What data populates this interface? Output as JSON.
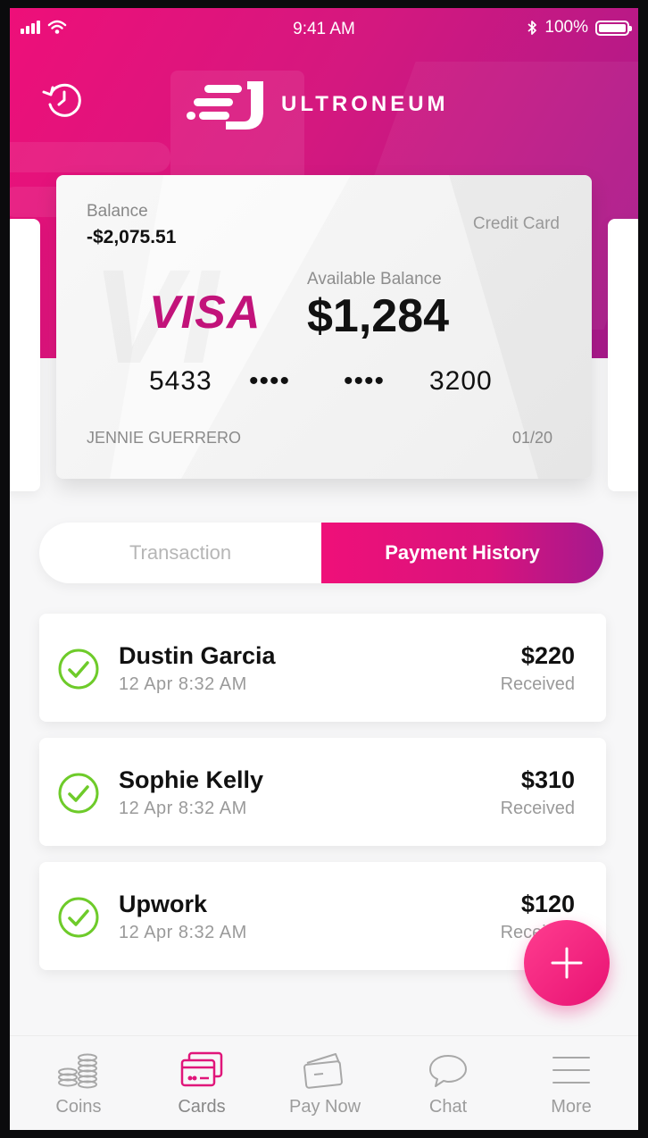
{
  "status_bar": {
    "time": "9:41 AM",
    "battery": "100%"
  },
  "brand": {
    "name": "ULTRONEUM"
  },
  "card": {
    "balance_label": "Balance",
    "balance_value": "-$2,075.51",
    "card_type": "Credit Card",
    "network": "VISA",
    "available_label": "Available Balance",
    "available_value": "$1,284",
    "number_groups": [
      "5433",
      "••••",
      "••••",
      "3200"
    ],
    "holder": "JENNIE GUERRERO",
    "expiry": "01/20"
  },
  "tabs": [
    {
      "label": "Transaction",
      "active": false
    },
    {
      "label": "Payment History",
      "active": true
    }
  ],
  "transactions": [
    {
      "name": "Dustin Garcia",
      "date": "12 Apr 8:32 AM",
      "amount": "$220",
      "status": "Received"
    },
    {
      "name": "Sophie Kelly",
      "date": "12 Apr 8:32 AM",
      "amount": "$310",
      "status": "Received"
    },
    {
      "name": "Upwork",
      "date": "12 Apr 8:32 AM",
      "amount": "$120",
      "status": "Received"
    }
  ],
  "nav": [
    {
      "label": "Coins",
      "icon": "coins-icon"
    },
    {
      "label": "Cards",
      "icon": "cards-icon",
      "active": true
    },
    {
      "label": "Pay Now",
      "icon": "wallet-icon"
    },
    {
      "label": "Chat",
      "icon": "chat-icon"
    },
    {
      "label": "More",
      "icon": "menu-icon"
    }
  ],
  "colors": {
    "accent": "#ee0f79",
    "accent_end": "#a5198e",
    "success": "#6ecb2a"
  }
}
